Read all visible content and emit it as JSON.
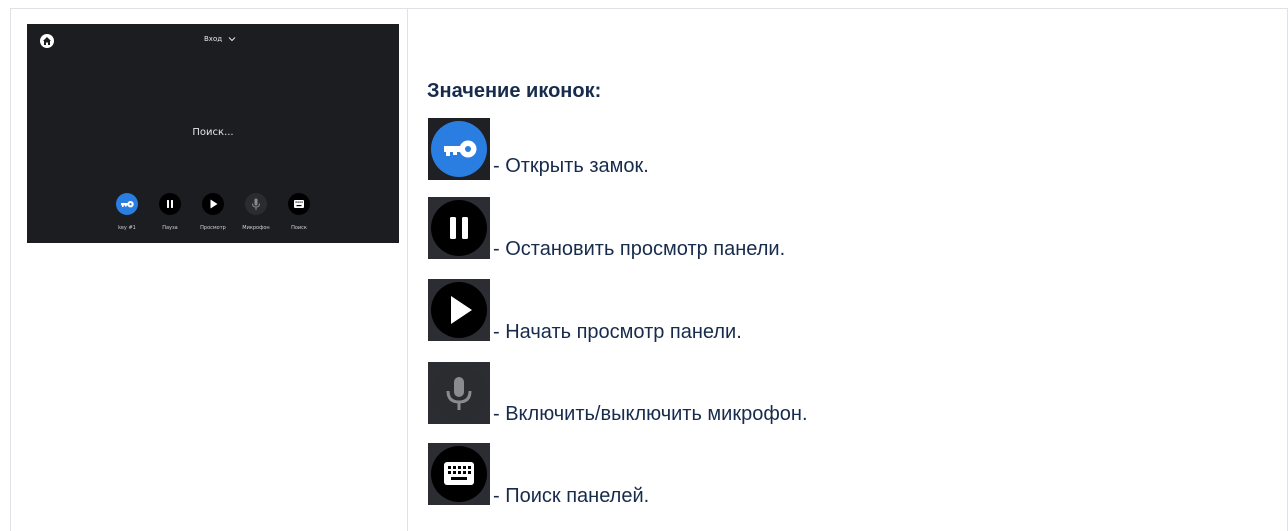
{
  "device": {
    "dropdown_label": "Вход",
    "status": "Поиск...",
    "buttons": [
      {
        "icon": "key-icon",
        "label": "key #1",
        "color": "#2a7de1"
      },
      {
        "icon": "pause-icon",
        "label": "Пауза",
        "color": "#000000"
      },
      {
        "icon": "play-icon",
        "label": "Просмотр",
        "color": "#000000"
      },
      {
        "icon": "microphone-icon",
        "label": "Микрофон",
        "color": "#2b2c30"
      },
      {
        "icon": "keyboard-icon",
        "label": "Поиск",
        "color": "#000000"
      }
    ]
  },
  "legend": {
    "heading": "Значение иконок:",
    "items": [
      {
        "icon": "key-icon",
        "text": "- Открыть замок."
      },
      {
        "icon": "pause-icon",
        "text": "- Остановить просмотр панели."
      },
      {
        "icon": "play-icon",
        "text": "- Начать просмотр панели."
      },
      {
        "icon": "microphone-icon",
        "text": "- Включить/выключить микрофон."
      },
      {
        "icon": "keyboard-icon",
        "text": "- Поиск панелей."
      }
    ]
  }
}
